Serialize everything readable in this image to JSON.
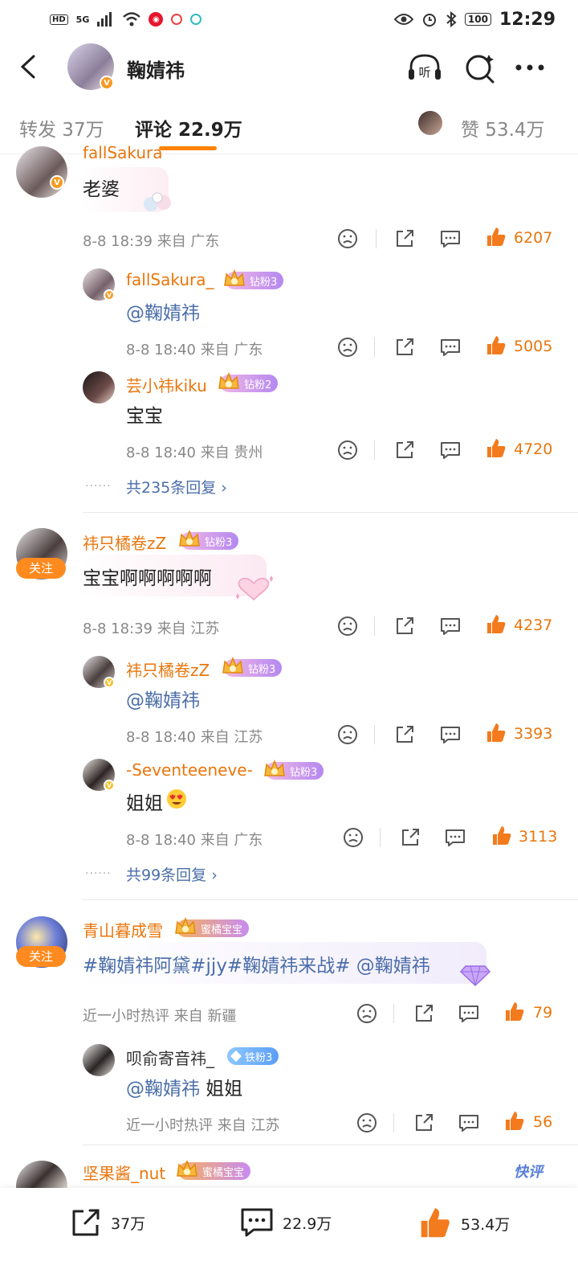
{
  "status_bar": {
    "left_badges": [
      "HD",
      "5G"
    ],
    "battery": "100",
    "time": "12:29"
  },
  "header": {
    "title": "鞠婧祎",
    "icons": [
      "back-icon",
      "listen-icon",
      "sparkle-search-icon",
      "more-icon"
    ],
    "listen_glyph": "听"
  },
  "tabs": {
    "repost": "转发 37万",
    "comments": "评论 22.9万",
    "likes": "赞 53.4万"
  },
  "comments": [
    {
      "name": "fallSakura_",
      "text": "老婆",
      "meta": "8-8 18:39 来自 广东",
      "likes": "6207",
      "replies": [
        {
          "name": "fallSakura_",
          "badge": "钻粉3",
          "text": "@鞠婧祎",
          "meta": "8-8 18:40 来自 广东",
          "likes": "5005"
        },
        {
          "name": "芸小祎kiku",
          "badge": "钻粉2",
          "text": "宝宝",
          "meta": "8-8 18:40 来自 贵州",
          "likes": "4720"
        }
      ],
      "more_replies": "共235条回复"
    },
    {
      "name": "祎只橘卷zZ",
      "badge": "钻粉3",
      "follow": "关注",
      "text": "宝宝啊啊啊啊啊",
      "meta": "8-8 18:39 来自 江苏",
      "likes": "4237",
      "replies": [
        {
          "name": "祎只橘卷zZ",
          "badge": "钻粉3",
          "text": "@鞠婧祎",
          "meta": "8-8 18:40 来自 江苏",
          "likes": "3393"
        },
        {
          "name": "-Seventeeneve-",
          "badge": "钻粉3",
          "text": "姐姐",
          "meta": "8-8 18:40 来自 广东",
          "likes": "3113"
        }
      ],
      "more_replies": "共99条回复"
    },
    {
      "name": "青山暮成雪",
      "badge": "蜜橘宝宝",
      "follow": "关注",
      "text_parts": [
        "#鞠婧祎阿黛#jjy#鞠婧祎来战#",
        " @鞠婧祎"
      ],
      "meta": "近一小时热评  来自 新疆",
      "likes": "79",
      "replies": [
        {
          "name": "呗俞寄音祎_",
          "badge": "铁粉3",
          "text_mention": "@鞠婧祎",
          "text_rest": " 姐姐",
          "meta": "近一小时热评  来自 江苏",
          "likes": "56"
        }
      ]
    },
    {
      "name": "坚果酱_nut",
      "badge": "蜜橘宝宝"
    }
  ],
  "quick_review": "快评",
  "bottom_bar": {
    "repost": "37万",
    "comment": "22.9万",
    "like": "53.4万"
  },
  "colors": {
    "accent": "#ff8200",
    "name": "#e8760d",
    "mention": "#4b6ea8"
  }
}
